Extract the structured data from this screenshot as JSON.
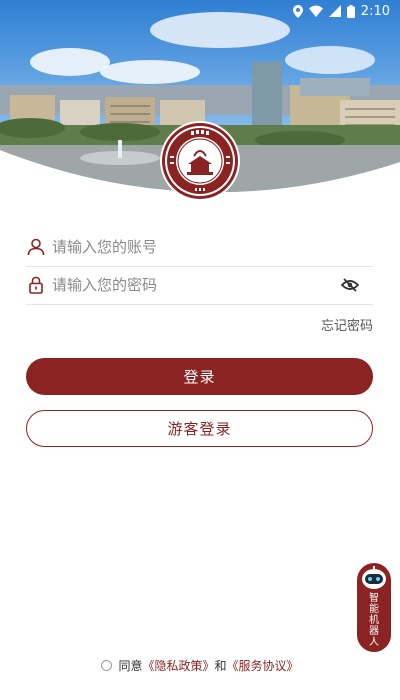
{
  "status_bar": {
    "time": "2:10"
  },
  "login": {
    "account_placeholder": "请输入您的账号",
    "password_placeholder": "请输入您的密码",
    "forgot_password": "忘记密码",
    "login_button": "登录",
    "guest_button": "游客登录"
  },
  "robot": {
    "label": "智能机器人"
  },
  "agreement": {
    "prefix": "同意",
    "privacy": "《隐私政策》",
    "and": "和",
    "service": "《服务协议》"
  },
  "colors": {
    "brand": "#8b2323",
    "sky": "#4a8fd6"
  },
  "icons": [
    "user-icon",
    "lock-icon",
    "eye-off-icon",
    "location-icon",
    "wifi-icon",
    "signal-icon",
    "battery-icon",
    "robot-icon"
  ]
}
